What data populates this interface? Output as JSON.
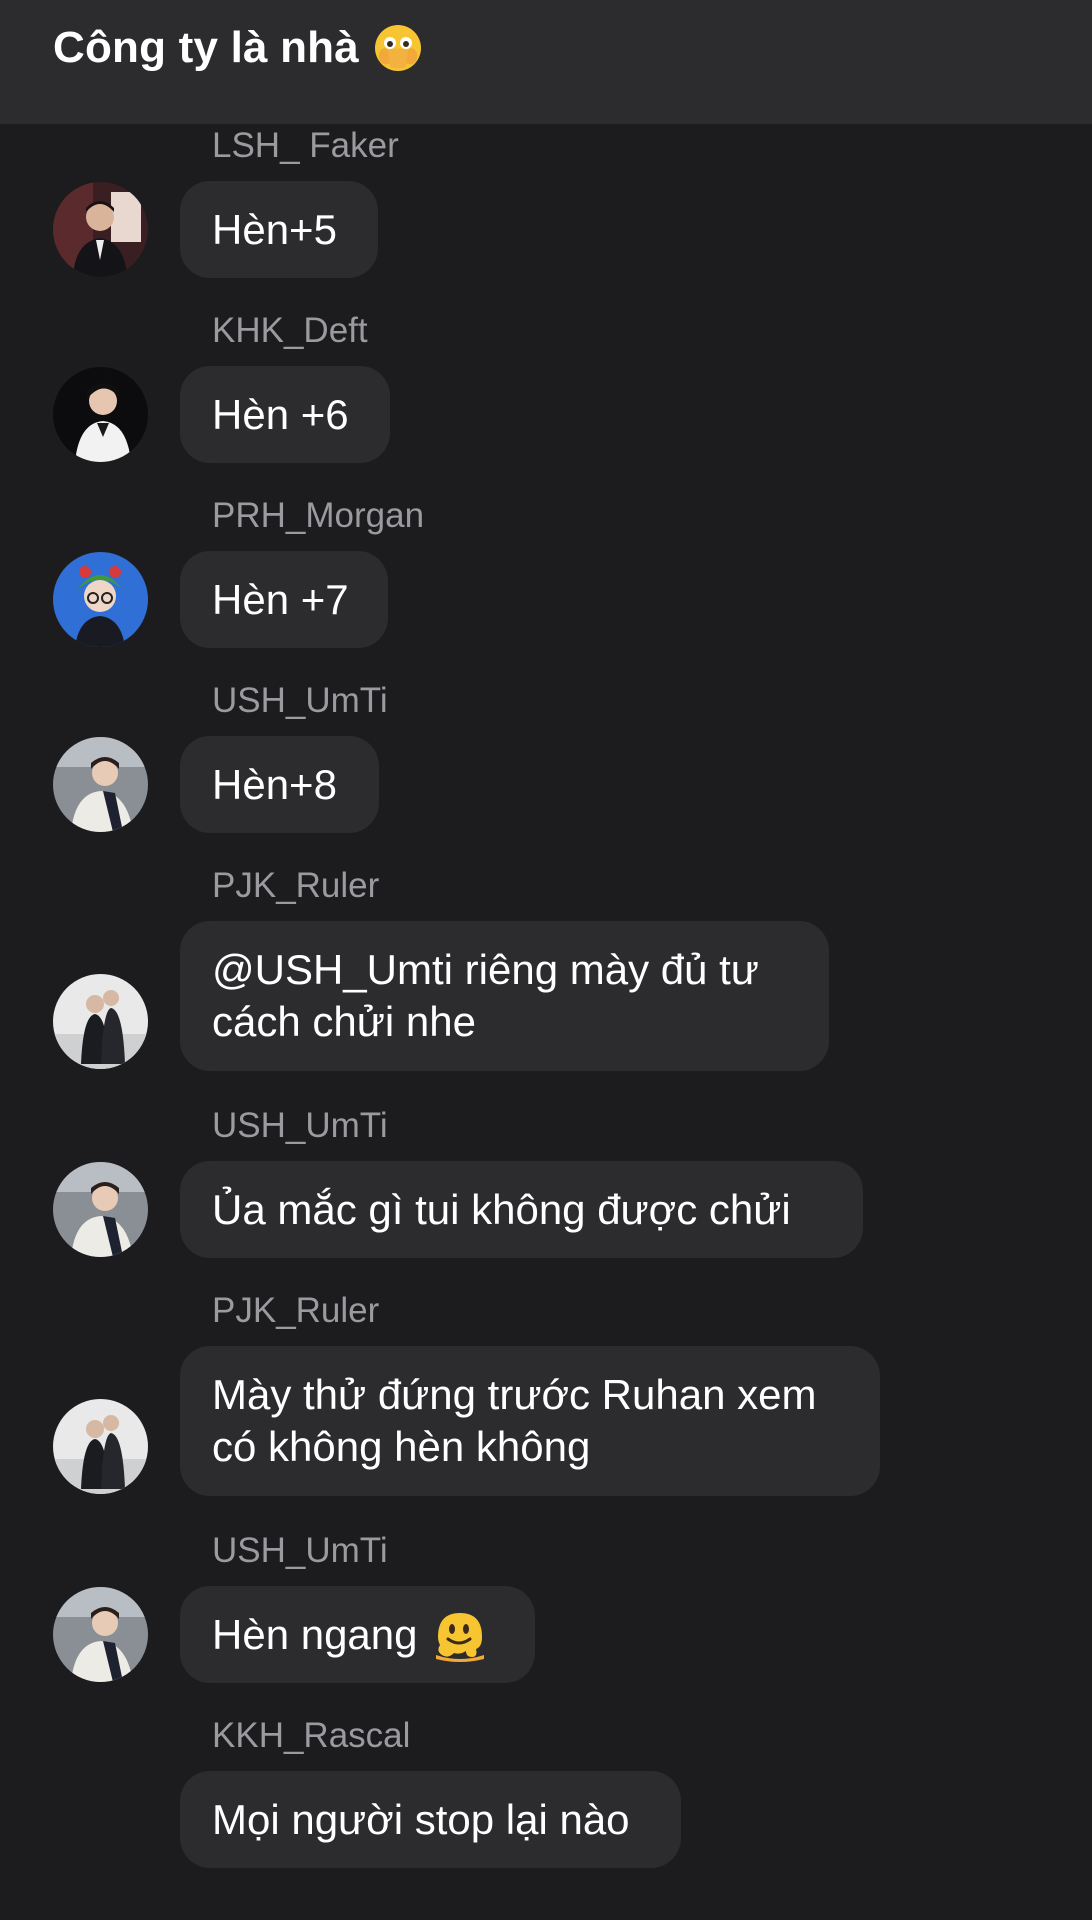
{
  "header": {
    "title": "Công ty là nhà",
    "emoji": "face-with-open-eyes-and-hand-over-mouth"
  },
  "messages": [
    {
      "sender": "LSH_ Faker",
      "text": "Hèn+5",
      "avatar": "avatar-faker"
    },
    {
      "sender": "KHK_Deft",
      "text": "Hèn +6",
      "avatar": "avatar-deft"
    },
    {
      "sender": "PRH_Morgan",
      "text": "Hèn +7",
      "avatar": "avatar-morgan"
    },
    {
      "sender": "USH_UmTi",
      "text": "Hèn+8",
      "avatar": "avatar-umti"
    },
    {
      "sender": "PJK_Ruler",
      "text": "@USH_Umti riêng mày đủ tư cách chửi nhe",
      "avatar": "avatar-ruler"
    },
    {
      "sender": "USH_UmTi",
      "text": "Ủa mắc gì tui không được chửi",
      "avatar": "avatar-umti"
    },
    {
      "sender": "PJK_Ruler",
      "text": "Mày thử đứng trước Ruhan xem có không hèn không",
      "avatar": "avatar-ruler"
    },
    {
      "sender": "USH_UmTi",
      "text": "Hèn ngang",
      "emoji": "melting-face",
      "avatar": "avatar-umti"
    },
    {
      "sender": "KKH_Rascal",
      "text": "Mọi người stop lại nào",
      "avatar": null
    }
  ]
}
